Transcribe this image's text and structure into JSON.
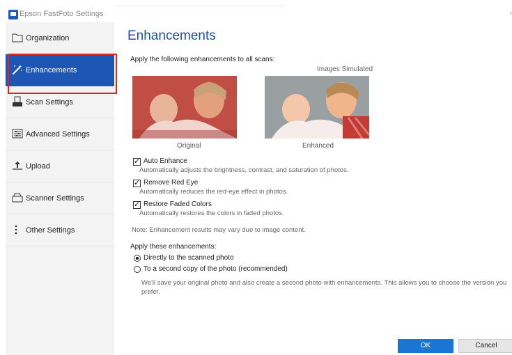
{
  "window": {
    "title": "Epson FastFoto Settings",
    "close": "×"
  },
  "sidebar": {
    "items": [
      {
        "label": "Organization",
        "icon": "folder-icon"
      },
      {
        "label": "Enhancements",
        "icon": "magic-wand-icon",
        "active": true
      },
      {
        "label": "Scan Settings",
        "icon": "scanner-icon"
      },
      {
        "label": "Advanced Settings",
        "icon": "sliders-icon"
      },
      {
        "label": "Upload",
        "icon": "upload-icon"
      },
      {
        "label": "Scanner Settings",
        "icon": "scanner-outline-icon"
      },
      {
        "label": "Other Settings",
        "icon": "more-vertical-icon"
      }
    ]
  },
  "main": {
    "title": "Enhancements",
    "intro": "Apply the following enhancements to all scans:",
    "images_note": "Images Simulated",
    "photo_captions": {
      "original": "Original",
      "enhanced": "Enhanced"
    },
    "options": [
      {
        "label": "Auto Enhance",
        "checked": true,
        "description": "Automatically adjusts the brightness, contrast, and saturation of photos."
      },
      {
        "label": "Remove Red Eye",
        "checked": true,
        "description": "Automatically reduces the red-eye effect in photos."
      },
      {
        "label": "Restore Faded Colors",
        "checked": true,
        "description": "Automatically restores the colors in faded photos."
      }
    ],
    "note": "Note: Enhancement results may vary due to image content.",
    "apply_label": "Apply these enhancements:",
    "apply_options": [
      {
        "label": "Directly to the scanned photo",
        "selected": true
      },
      {
        "label": "To a second copy of the photo (recommended)",
        "selected": false
      }
    ],
    "apply_description": "We'll save your original photo and also create a second photo with enhancements. This allows you to choose the version you prefer."
  },
  "buttons": {
    "ok": "OK",
    "cancel": "Cancel"
  },
  "colors": {
    "accent": "#1e56b5",
    "ok_button": "#1976d2",
    "highlight": "#e0251f",
    "title": "#1f4e9e"
  }
}
